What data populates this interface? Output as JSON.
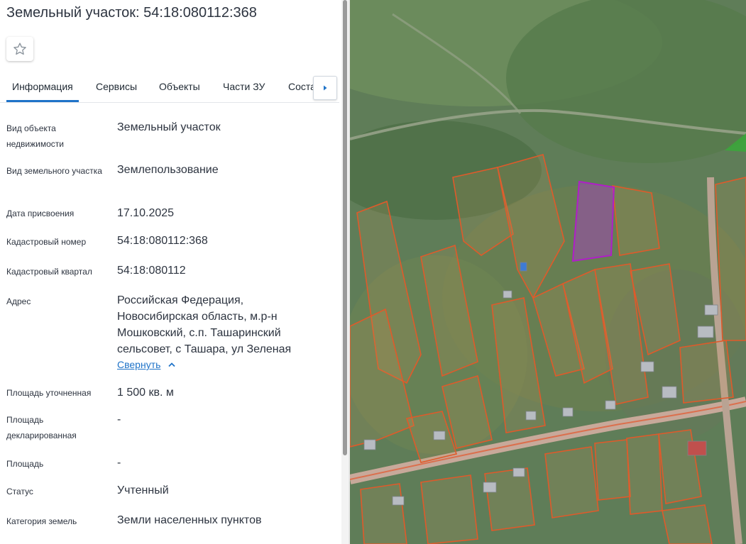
{
  "header": {
    "title": "Земельный участок: 54:18:080112:368"
  },
  "tabs": [
    {
      "label": "Информация"
    },
    {
      "label": "Сервисы"
    },
    {
      "label": "Объекты"
    },
    {
      "label": "Части ЗУ"
    },
    {
      "label": "Соста"
    }
  ],
  "info": {
    "object_type_label": "Вид объекта недвижимости",
    "object_type_value": "Земельный участок",
    "land_type_label": "Вид земельного участка",
    "land_type_value": "Землепользование",
    "assign_date_label": "Дата присвоения",
    "assign_date_value": "17.10.2025",
    "cad_number_label": "Кадастровый номер",
    "cad_number_value": "54:18:080112:368",
    "cad_quarter_label": "Кадастровый квартал",
    "cad_quarter_value": "54:18:080112",
    "address_label": "Адрес",
    "address_value": "Российская Федерация, Новосибирская область, м.р-н Мошковский, с.п. Ташаринский сельсовет, с Ташара, ул Зеленая",
    "collapse_label": "Свернуть",
    "area_specified_label": "Площадь уточненная",
    "area_specified_value": "1 500 кв. м",
    "area_declared_label": "Площадь декларированная",
    "area_declared_value": "-",
    "area_label": "Площадь",
    "area_value": "-",
    "status_label": "Статус",
    "status_value": "Учтенный",
    "category_label": "Категория земель",
    "category_value": "Земли населенных пунктов"
  },
  "icons": {
    "favorite": "star-icon",
    "tabs_next": "chevron-right-icon",
    "collapse": "chevron-up-icon"
  },
  "colors": {
    "accent": "#1f73c8",
    "parcel_border": "#e05a2a",
    "selected_parcel": "#b01ec8"
  }
}
